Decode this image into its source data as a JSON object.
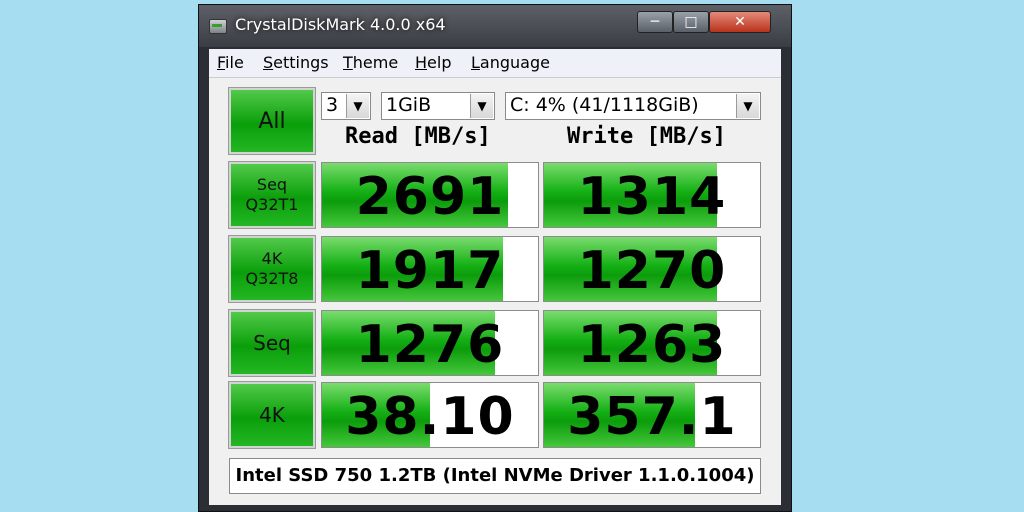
{
  "window": {
    "title": "CrystalDiskMark 4.0.0 x64"
  },
  "menu": [
    "File",
    "Settings",
    "Theme",
    "Help",
    "Language"
  ],
  "controls": {
    "all_label": "All",
    "count": "3",
    "size": "1GiB",
    "drive": "C: 4% (41/1118GiB)"
  },
  "headers": {
    "read": "Read [MB/s]",
    "write": "Write [MB/s]"
  },
  "rows": [
    {
      "label_line1": "Seq",
      "label_line2": "Q32T1",
      "read": "2691",
      "write": "1314",
      "read_fill": 0.86,
      "write_fill": 0.8
    },
    {
      "label_line1": "4K",
      "label_line2": "Q32T8",
      "read": "1917",
      "write": "1270",
      "read_fill": 0.84,
      "write_fill": 0.8
    },
    {
      "label_line1": "Seq",
      "label_line2": "",
      "read": "1276",
      "write": "1263",
      "read_fill": 0.8,
      "write_fill": 0.8
    },
    {
      "label_line1": "4K",
      "label_line2": "",
      "read": "38.10",
      "write": "357.1",
      "read_fill": 0.5,
      "write_fill": 0.7
    }
  ],
  "status": "Intel SSD 750 1.2TB (Intel NVMe Driver 1.1.0.1004)",
  "colors": {
    "green": "#0a9f0a",
    "background": "#a6ddf0"
  }
}
